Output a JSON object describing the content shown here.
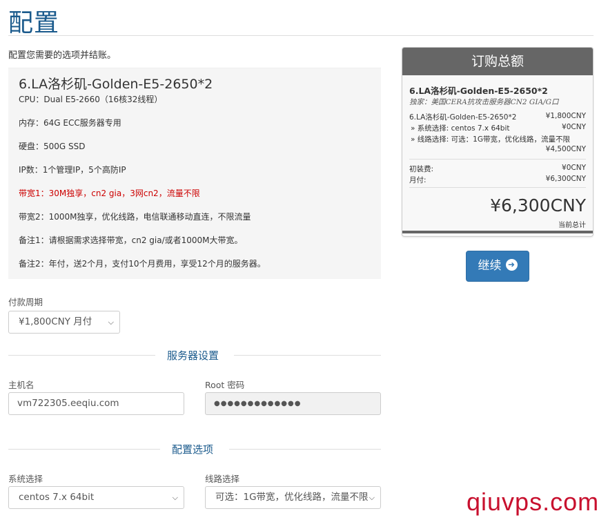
{
  "page": {
    "title": "配置",
    "intro": "配置您需要的选项并结账。"
  },
  "product": {
    "name": "6.LA洛杉矶-Golden-E5-2650*2",
    "specs": {
      "cpu": "CPU：Dual E5-2660（16核32线程）",
      "memory": "内存：64G ECC服务器专用",
      "disk": "硬盘：500G SSD",
      "ip": "IP数：1个管理IP，5个高防IP",
      "bandwidth1": "带宽1：30M独享，cn2 gia，3网cn2，流量不限",
      "bandwidth2": "带宽2：1000M独享，优化线路，电信联通移动直连，不限流量",
      "note1": "备注1：请根据需求选择带宽，cn2 gia/或者1000M大带宽。",
      "note2": "备注2：年付，送2个月，支付10个月费用，享受12个月的服务器。"
    }
  },
  "billing": {
    "label": "付款周期",
    "selected": "¥1,800CNY 月付"
  },
  "server_settings": {
    "heading": "服务器设置",
    "hostname_label": "主机名",
    "hostname_value": "vm722305.eeqiu.com",
    "root_label": "Root 密码",
    "root_value": "●●●●●●●●●●●●●"
  },
  "config_options": {
    "heading": "配置选项",
    "os_label": "系统选择",
    "os_selected": "centos 7.x 64bit",
    "line_label": "线路选择",
    "line_selected": "可选：1G带宽，优化线路，流量不限"
  },
  "summary": {
    "header": "订购总额",
    "product_name": "6.LA洛杉矶-Golden-E5-2650*2",
    "product_desc": "独家：美国CERA抗攻击服务器CN2 GIA/G口",
    "lines": [
      {
        "label": "6.LA洛杉矶-Golden-E5-2650*2",
        "price": "¥1,800CNY"
      },
      {
        "label": "» 系统选择: centos 7.x 64bit",
        "price": "¥0CNY"
      },
      {
        "label": "» 线路选择: 可选：1G带宽，优化线路，流量不限",
        "price": "¥4,500CNY"
      }
    ],
    "setup_label": "初装费:",
    "setup_value": "¥0CNY",
    "monthly_label": "月付:",
    "monthly_value": "¥6,300CNY",
    "total": "¥6,300CNY",
    "total_label": "当前总计"
  },
  "continue_button": {
    "label": "继续",
    "icon": "arrow-circle-right-icon"
  },
  "watermark": "qiuvps.com",
  "colors": {
    "accent": "#1a5a8c",
    "button": "#337ab7",
    "summary_header": "#666666",
    "warning_text": "#cc0000",
    "watermark": "#c8102e"
  }
}
